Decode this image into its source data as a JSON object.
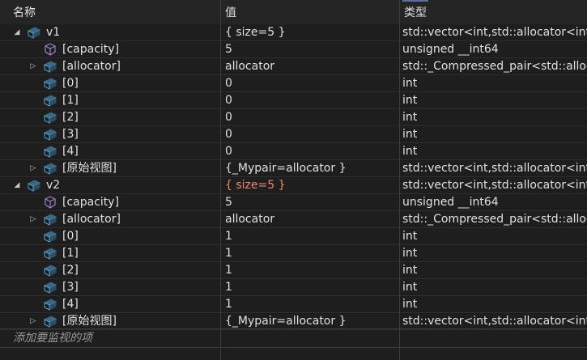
{
  "header": {
    "name": "名称",
    "value": "值",
    "type": "类型"
  },
  "rows": [
    {
      "level": 0,
      "expander": "expanded",
      "icon": "field-icon",
      "name": "v1",
      "value": "{ size=5 }",
      "type": "std::vector<int,std::allocator<int> >",
      "changed": false
    },
    {
      "level": 1,
      "expander": "none",
      "icon": "property-icon",
      "name": "[capacity]",
      "value": "5",
      "type": "unsigned __int64",
      "changed": false
    },
    {
      "level": 1,
      "expander": "collapsed",
      "icon": "field-icon",
      "name": "[allocator]",
      "value": "allocator",
      "type": "std::_Compressed_pair<std::allocator<int>",
      "changed": false
    },
    {
      "level": 1,
      "expander": "none",
      "icon": "field-icon",
      "name": "[0]",
      "value": "0",
      "type": "int",
      "changed": false
    },
    {
      "level": 1,
      "expander": "none",
      "icon": "field-icon",
      "name": "[1]",
      "value": "0",
      "type": "int",
      "changed": false
    },
    {
      "level": 1,
      "expander": "none",
      "icon": "field-icon",
      "name": "[2]",
      "value": "0",
      "type": "int",
      "changed": false
    },
    {
      "level": 1,
      "expander": "none",
      "icon": "field-icon",
      "name": "[3]",
      "value": "0",
      "type": "int",
      "changed": false
    },
    {
      "level": 1,
      "expander": "none",
      "icon": "field-icon",
      "name": "[4]",
      "value": "0",
      "type": "int",
      "changed": false
    },
    {
      "level": 1,
      "expander": "collapsed",
      "icon": "field-icon",
      "name": "[原始视图]",
      "value": "{_Mypair=allocator }",
      "type": "std::vector<int,std::allocator<int> >",
      "changed": false
    },
    {
      "level": 0,
      "expander": "expanded",
      "icon": "field-icon",
      "name": "v2",
      "value": "{ size=5 }",
      "type": "std::vector<int,std::allocator<int> >",
      "changed": true
    },
    {
      "level": 1,
      "expander": "none",
      "icon": "property-icon",
      "name": "[capacity]",
      "value": "5",
      "type": "unsigned __int64",
      "changed": false
    },
    {
      "level": 1,
      "expander": "collapsed",
      "icon": "field-icon",
      "name": "[allocator]",
      "value": "allocator",
      "type": "std::_Compressed_pair<std::allocator<int>",
      "changed": false
    },
    {
      "level": 1,
      "expander": "none",
      "icon": "field-icon",
      "name": "[0]",
      "value": "1",
      "type": "int",
      "changed": false
    },
    {
      "level": 1,
      "expander": "none",
      "icon": "field-icon",
      "name": "[1]",
      "value": "1",
      "type": "int",
      "changed": false
    },
    {
      "level": 1,
      "expander": "none",
      "icon": "field-icon",
      "name": "[2]",
      "value": "1",
      "type": "int",
      "changed": false
    },
    {
      "level": 1,
      "expander": "none",
      "icon": "field-icon",
      "name": "[3]",
      "value": "1",
      "type": "int",
      "changed": false
    },
    {
      "level": 1,
      "expander": "none",
      "icon": "field-icon",
      "name": "[4]",
      "value": "1",
      "type": "int",
      "changed": false
    },
    {
      "level": 1,
      "expander": "collapsed",
      "icon": "field-icon",
      "name": "[原始视图]",
      "value": "{_Mypair=allocator }",
      "type": "std::vector<int,std::allocator<int> >",
      "changed": false
    }
  ],
  "add_watch": "添加要监视的项",
  "colors": {
    "background": "#1e1e1e",
    "text": "#e0e0e0",
    "changed_value": "#f48771",
    "field_icon": "#4fa6d8",
    "property_icon": "#9b80c9"
  }
}
